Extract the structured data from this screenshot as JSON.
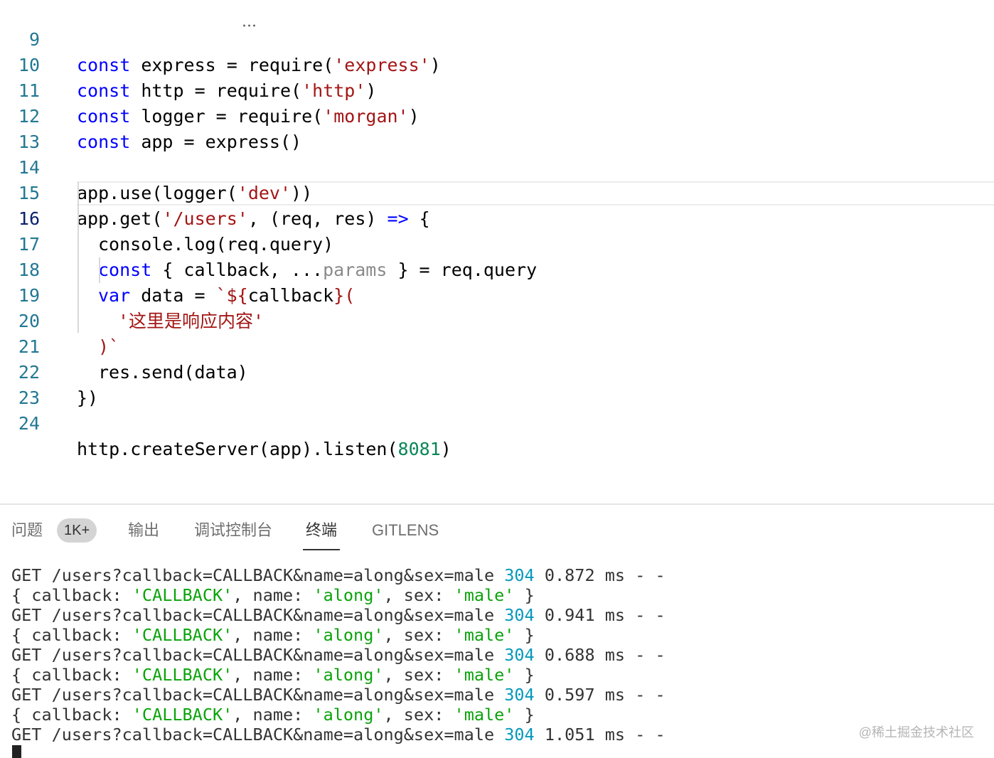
{
  "editor": {
    "lines": [
      {
        "num": "9",
        "kw": "const",
        "rest": " express = require(",
        "str": "'express'",
        "end": ")"
      },
      {
        "num": "10",
        "kw": "const",
        "rest": " http = require(",
        "str": "'http'",
        "end": ")"
      },
      {
        "num": "11",
        "kw": "const",
        "rest": " logger = require(",
        "str": "'morgan'",
        "end": ")"
      },
      {
        "num": "12",
        "kw": "const",
        "rest": " app = express()"
      },
      {
        "num": "13"
      },
      {
        "num": "14",
        "a": "app.use(logger(",
        "str": "'dev'",
        "end": "))"
      },
      {
        "num": "15",
        "a": "app.get(",
        "str": "'/users'",
        "b": ", (req, res) ",
        "arrow": "=>",
        "end": " {"
      },
      {
        "num": "16",
        "a": "console.log(req.query)"
      },
      {
        "num": "17",
        "kw": "const",
        "a": " { callback, ...",
        "dim": "params",
        "end": " } = req.query"
      },
      {
        "num": "18",
        "kw": "var",
        "a": " data = ",
        "str": "`${",
        "b": "callback",
        "str2": "}("
      },
      {
        "num": "19",
        "str": "'这里是响应内容'"
      },
      {
        "num": "20",
        "str": ")`"
      },
      {
        "num": "21",
        "a": "res.send(data)"
      },
      {
        "num": "22",
        "a": "})"
      },
      {
        "num": "23"
      },
      {
        "num": "24",
        "a": "http.createServer(app).listen(",
        "numlit": "8081",
        "end": ")"
      }
    ]
  },
  "panel": {
    "tabs": [
      {
        "label": "问题",
        "active": false
      },
      {
        "label": "输出",
        "active": false
      },
      {
        "label": "调试控制台",
        "active": false
      },
      {
        "label": "终端",
        "active": true
      },
      {
        "label": "GITLENS",
        "active": false
      }
    ],
    "problems_badge": "1K+"
  },
  "terminal": {
    "requests": [
      {
        "method_path": "GET /users?callback=CALLBACK&name=along&sex=male ",
        "status": "304",
        "tail": " 0.872 ms - -"
      },
      {
        "method_path": "GET /users?callback=CALLBACK&name=along&sex=male ",
        "status": "304",
        "tail": " 0.941 ms - -"
      },
      {
        "method_path": "GET /users?callback=CALLBACK&name=along&sex=male ",
        "status": "304",
        "tail": " 0.688 ms - -"
      },
      {
        "method_path": "GET /users?callback=CALLBACK&name=along&sex=male ",
        "status": "304",
        "tail": " 0.597 ms - -"
      },
      {
        "method_path": "GET /users?callback=CALLBACK&name=along&sex=male ",
        "status": "304",
        "tail": " 1.051 ms - -"
      }
    ],
    "query_log": {
      "open": "{ callback: ",
      "callback": "'CALLBACK'",
      "sep1": ", name: ",
      "name": "'along'",
      "sep2": ", sex: ",
      "sex": "'male'",
      "close": " }"
    }
  },
  "watermark": "@稀土掘金技术社区",
  "colors": {
    "keyword": "#0000ff",
    "string": "#a31515",
    "number": "#098658",
    "status": "#0598bc",
    "term_string": "#0aa30a"
  }
}
